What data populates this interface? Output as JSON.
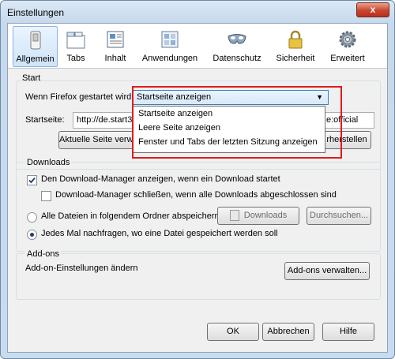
{
  "window": {
    "title": "Einstellungen",
    "close_label": "x"
  },
  "toolbar": {
    "items": [
      {
        "label": "Allgemein",
        "icon": "switch-icon"
      },
      {
        "label": "Tabs",
        "icon": "tabs-icon"
      },
      {
        "label": "Inhalt",
        "icon": "content-icon"
      },
      {
        "label": "Anwendungen",
        "icon": "applications-icon"
      },
      {
        "label": "Datenschutz",
        "icon": "mask-icon"
      },
      {
        "label": "Sicherheit",
        "icon": "lock-icon"
      },
      {
        "label": "Erweitert",
        "icon": "gear-icon"
      }
    ]
  },
  "start": {
    "title": "Start",
    "startup_label": "Wenn Firefox gestartet wird:",
    "dropdown": {
      "selected": "Startseite anzeigen",
      "options": [
        "Startseite anzeigen",
        "Leere Seite anzeigen",
        "Fenster und Tabs der letzten Sitzung anzeigen"
      ]
    },
    "homepage_label": "Startseite:",
    "homepage_value": "http://de.start3.m",
    "homepage_value_tail": "e:official",
    "current_page_button": "Aktuelle Seite verwe",
    "restore_button": "rherstellen"
  },
  "downloads": {
    "title": "Downloads",
    "show_manager": "Den Download-Manager anzeigen, wenn ein Download startet",
    "close_manager": "Download-Manager schließen, wenn alle Downloads abgeschlossen sind",
    "save_all": "Alle Dateien in folgendem Ordner abspeichern:",
    "folder": "Downloads",
    "browse_button": "Durchsuchen...",
    "ask_each": "Jedes Mal nachfragen, wo eine Datei gespeichert werden soll"
  },
  "addons": {
    "title": "Add-ons",
    "text": "Add-on-Einstellungen ändern",
    "manage_button": "Add-ons verwalten..."
  },
  "footer": {
    "ok": "OK",
    "cancel": "Abbrechen",
    "help": "Hilfe"
  },
  "colors": {
    "highlight": "#e01b1b",
    "selected_tab": "#cfe4f8"
  }
}
